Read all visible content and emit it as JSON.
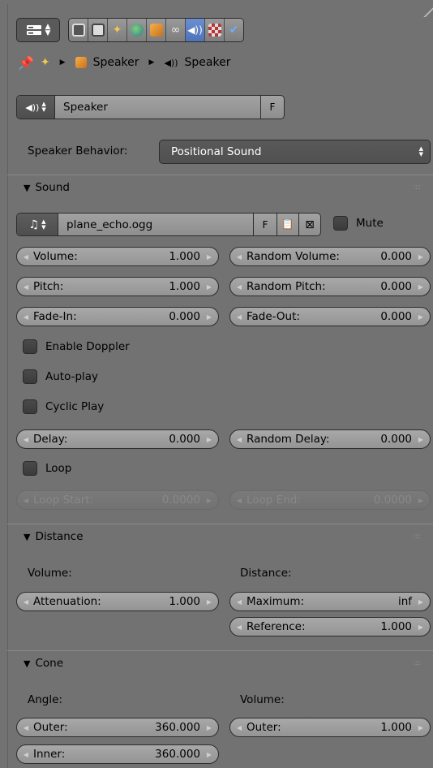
{
  "header": {
    "editor_type_icon": "properties-editor-icon",
    "tabs": [
      {
        "icon": "render-icon"
      },
      {
        "icon": "render-layers-icon"
      },
      {
        "icon": "scene-icon"
      },
      {
        "icon": "world-icon"
      },
      {
        "icon": "object-icon"
      },
      {
        "icon": "constraints-icon"
      },
      {
        "icon": "speaker-data-icon",
        "active": true
      },
      {
        "icon": "texture-icon"
      },
      {
        "icon": "modifier-icon"
      }
    ]
  },
  "breadcrumb": {
    "items": [
      "Speaker",
      "Speaker"
    ]
  },
  "datablock": {
    "name": "Speaker",
    "fake_user": "F"
  },
  "behavior": {
    "label": "Speaker Behavior:",
    "value": "Positional Sound"
  },
  "sound_panel": {
    "title": "Sound",
    "file": "plane_echo.ogg",
    "fake_user": "F",
    "mute_label": "Mute",
    "volume": {
      "label": "Volume:",
      "value": "1.000"
    },
    "random_volume": {
      "label": "Random Volume:",
      "value": "0.000"
    },
    "pitch": {
      "label": "Pitch:",
      "value": "1.000"
    },
    "random_pitch": {
      "label": "Random Pitch:",
      "value": "0.000"
    },
    "fade_in": {
      "label": "Fade-In:",
      "value": "0.000"
    },
    "fade_out": {
      "label": "Fade-Out:",
      "value": "0.000"
    },
    "enable_doppler": "Enable Doppler",
    "auto_play": "Auto-play",
    "cyclic_play": "Cyclic Play",
    "delay": {
      "label": "Delay:",
      "value": "0.000"
    },
    "random_delay": {
      "label": "Random Delay:",
      "value": "0.000"
    },
    "loop": "Loop",
    "loop_start": {
      "label": "Loop Start:",
      "value": "0.0000"
    },
    "loop_end": {
      "label": "Loop End:",
      "value": "0.0000"
    }
  },
  "distance_panel": {
    "title": "Distance",
    "volume_label": "Volume:",
    "distance_label": "Distance:",
    "attenuation": {
      "label": "Attenuation:",
      "value": "1.000"
    },
    "maximum": {
      "label": "Maximum:",
      "value": "inf"
    },
    "reference": {
      "label": "Reference:",
      "value": "1.000"
    }
  },
  "cone_panel": {
    "title": "Cone",
    "angle_label": "Angle:",
    "volume_label": "Volume:",
    "angle_outer": {
      "label": "Outer:",
      "value": "360.000"
    },
    "angle_inner": {
      "label": "Inner:",
      "value": "360.000"
    },
    "volume_outer": {
      "label": "Outer:",
      "value": "1.000"
    }
  },
  "colors": {
    "panel_bg": "#727272",
    "active_tab": "#5680c2"
  }
}
